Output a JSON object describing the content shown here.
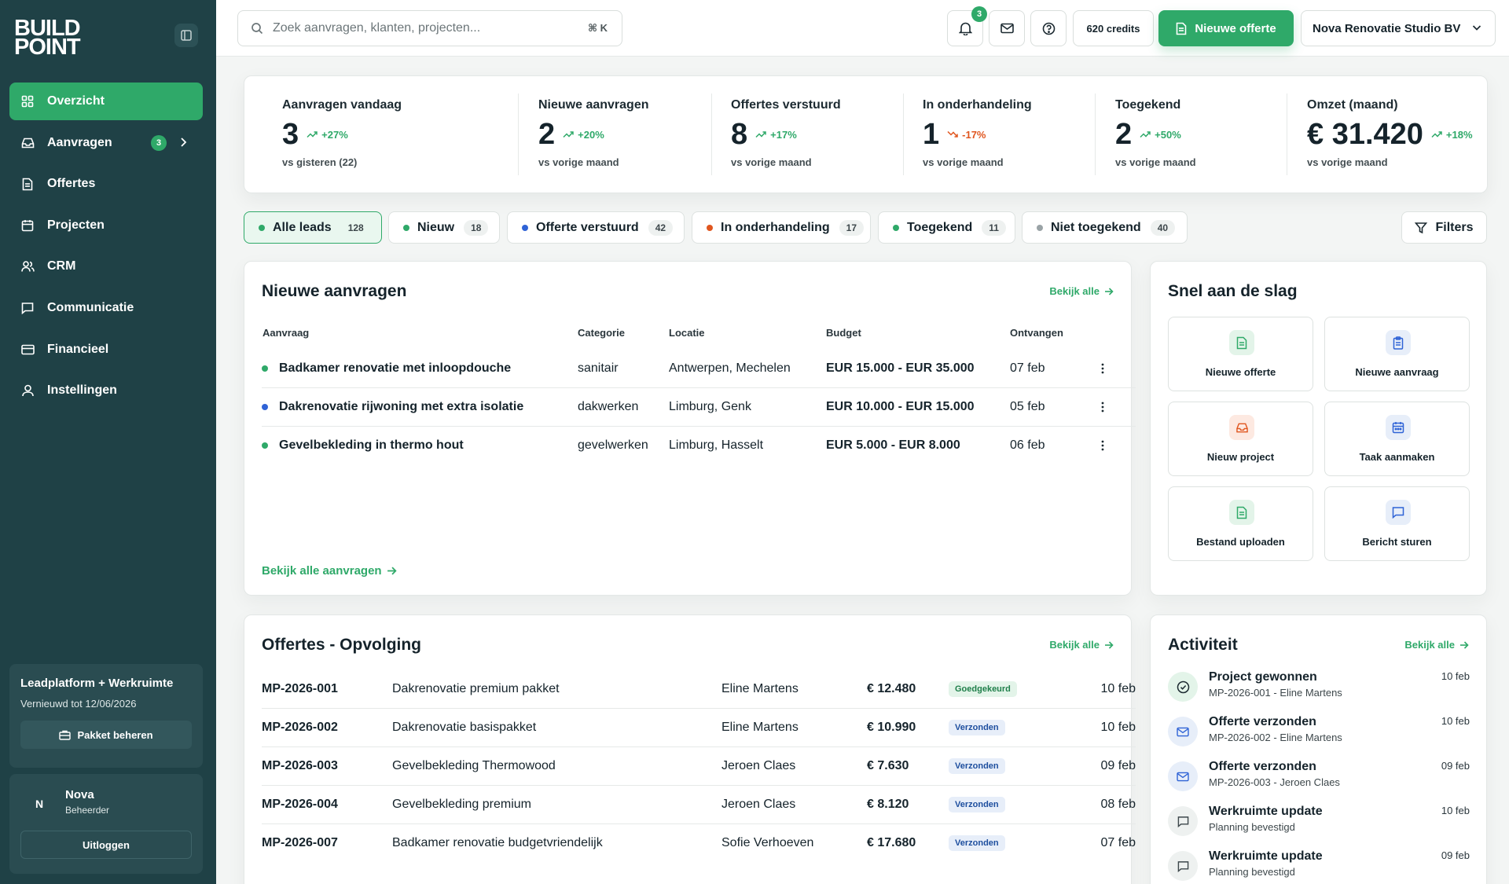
{
  "brand": {
    "line1": "BUILD",
    "line2": "POINT"
  },
  "nav": [
    {
      "label": "Overzicht",
      "icon": "grid-icon",
      "active": true
    },
    {
      "label": "Aanvragen",
      "icon": "inbox-icon",
      "badge": "3"
    },
    {
      "label": "Offertes",
      "icon": "file-icon"
    },
    {
      "label": "Projecten",
      "icon": "calendar-icon"
    },
    {
      "label": "CRM",
      "icon": "users-icon"
    },
    {
      "label": "Communicatie",
      "icon": "message-icon"
    },
    {
      "label": "Financieel",
      "icon": "card-icon"
    },
    {
      "label": "Instellingen",
      "icon": "user-icon"
    }
  ],
  "package": {
    "title": "Leadplatform + Werkruimte",
    "renewal": "Vernieuwd tot 12/06/2026",
    "button": "Pakket beheren"
  },
  "user": {
    "initial": "N",
    "name": "Nova",
    "role": "Beheerder",
    "logout": "Uitloggen"
  },
  "topbar": {
    "search_placeholder": "Zoek aanvragen, klanten, projecten...",
    "search_shortcut": "⌘ K",
    "notifications": "3",
    "credits": "620 credits",
    "new_quote": "Nieuwe offerte",
    "company": "Nova Renovatie Studio BV"
  },
  "stats": [
    {
      "label": "Aanvragen vandaag",
      "value": "3",
      "delta": "+27%",
      "trend": "up",
      "sub": "vs gisteren (22)"
    },
    {
      "label": "Nieuwe aanvragen",
      "value": "2",
      "delta": "+20%",
      "trend": "up",
      "sub": "vs vorige maand"
    },
    {
      "label": "Offertes verstuurd",
      "value": "8",
      "delta": "+17%",
      "trend": "up",
      "sub": "vs vorige maand"
    },
    {
      "label": "In onderhandeling",
      "value": "1",
      "delta": "-17%",
      "trend": "down",
      "sub": "vs vorige maand"
    },
    {
      "label": "Toegekend",
      "value": "2",
      "delta": "+50%",
      "trend": "up",
      "sub": "vs vorige maand"
    },
    {
      "label": "Omzet (maand)",
      "value": "€ 31.420",
      "delta": "+18%",
      "trend": "up",
      "sub": "vs vorige maand"
    }
  ],
  "filters": [
    {
      "label": "Alle leads",
      "count": "128",
      "color": "#2fa969"
    },
    {
      "label": "Nieuw",
      "count": "18",
      "color": "#2fa969"
    },
    {
      "label": "Offerte verstuurd",
      "count": "42",
      "color": "#2f63d6"
    },
    {
      "label": "In onderhandeling",
      "count": "17",
      "color": "#e0561f"
    },
    {
      "label": "Toegekend",
      "count": "11",
      "color": "#2fa969"
    },
    {
      "label": "Niet toegekend",
      "count": "40",
      "color": "#9aa3a6"
    }
  ],
  "filters_button": "Filters",
  "requests": {
    "title": "Nieuwe aanvragen",
    "view_all": "Bekijk alle",
    "footer_link": "Bekijk alle aanvragen",
    "columns": [
      "Aanvraag",
      "Categorie",
      "Locatie",
      "Budget",
      "Ontvangen"
    ],
    "rows": [
      {
        "title": "Badkamer renovatie met inloopdouche",
        "category": "sanitair",
        "location": "Antwerpen, Mechelen",
        "budget": "EUR 15.000 - EUR 35.000",
        "received": "07 feb",
        "dot": "#2fa969"
      },
      {
        "title": "Dakrenovatie rijwoning met extra isolatie",
        "category": "dakwerken",
        "location": "Limburg, Genk",
        "budget": "EUR 10.000 - EUR 15.000",
        "received": "05 feb",
        "dot": "#2f63d6"
      },
      {
        "title": "Gevelbekleding in thermo hout",
        "category": "gevelwerken",
        "location": "Limburg, Hasselt",
        "budget": "EUR 5.000 - EUR 8.000",
        "received": "06 feb",
        "dot": "#2fa969"
      }
    ]
  },
  "quick": {
    "title": "Snel aan de slag",
    "actions": [
      {
        "label": "Nieuwe offerte",
        "icon": "file-icon",
        "color": "#2fa969",
        "bg": "#e3f4e9"
      },
      {
        "label": "Nieuwe aanvraag",
        "icon": "clipboard-icon",
        "color": "#2f63d6",
        "bg": "#e7eef9"
      },
      {
        "label": "Nieuw project",
        "icon": "inbox-icon",
        "color": "#e0561f",
        "bg": "#fde9e1"
      },
      {
        "label": "Taak aanmaken",
        "icon": "calendar-icon",
        "color": "#2f63d6",
        "bg": "#e7eef9"
      },
      {
        "label": "Bestand uploaden",
        "icon": "file-icon",
        "color": "#2fa969",
        "bg": "#e3f4e9"
      },
      {
        "label": "Bericht sturen",
        "icon": "message-icon",
        "color": "#2f63d6",
        "bg": "#e7eef9"
      }
    ]
  },
  "quotes": {
    "title": "Offertes - Opvolging",
    "view_all": "Bekijk alle",
    "rows": [
      {
        "code": "MP-2026-001",
        "desc": "Dakrenovatie premium pakket",
        "client": "Eline Martens",
        "amount": "€ 12.480",
        "status": "Goedgekeurd",
        "status_type": "green",
        "date": "10 feb"
      },
      {
        "code": "MP-2026-002",
        "desc": "Dakrenovatie basispakket",
        "client": "Eline Martens",
        "amount": "€ 10.990",
        "status": "Verzonden",
        "status_type": "blue",
        "date": "10 feb"
      },
      {
        "code": "MP-2026-003",
        "desc": "Gevelbekleding Thermowood",
        "client": "Jeroen Claes",
        "amount": "€ 7.630",
        "status": "Verzonden",
        "status_type": "blue",
        "date": "09 feb"
      },
      {
        "code": "MP-2026-004",
        "desc": "Gevelbekleding premium",
        "client": "Jeroen Claes",
        "amount": "€ 8.120",
        "status": "Verzonden",
        "status_type": "blue",
        "date": "08 feb"
      },
      {
        "code": "MP-2026-007",
        "desc": "Badkamer renovatie budgetvriendelijk",
        "client": "Sofie Verhoeven",
        "amount": "€ 17.680",
        "status": "Verzonden",
        "status_type": "blue",
        "date": "07 feb"
      }
    ]
  },
  "activity": {
    "title": "Activiteit",
    "view_all": "Bekijk alle",
    "items": [
      {
        "title": "Project gewonnen",
        "sub": "MP-2026-001 - Eline Martens",
        "date": "10 feb",
        "icon": "check-circle-icon",
        "color": "#2fa969",
        "bg": "#e3f4e9"
      },
      {
        "title": "Offerte verzonden",
        "sub": "MP-2026-002 - Eline Martens",
        "date": "10 feb",
        "icon": "mail-icon",
        "color": "#2f63d6",
        "bg": "#e7eef9"
      },
      {
        "title": "Offerte verzonden",
        "sub": "MP-2026-003 - Jeroen Claes",
        "date": "09 feb",
        "icon": "mail-icon",
        "color": "#2f63d6",
        "bg": "#e7eef9"
      },
      {
        "title": "Werkruimte update",
        "sub": "Planning bevestigd",
        "date": "10 feb",
        "icon": "message-icon",
        "color": "#3d474b",
        "bg": "#eef1f0"
      },
      {
        "title": "Werkruimte update",
        "sub": "Planning bevestigd",
        "date": "09 feb",
        "icon": "message-icon",
        "color": "#3d474b",
        "bg": "#eef1f0"
      }
    ]
  }
}
